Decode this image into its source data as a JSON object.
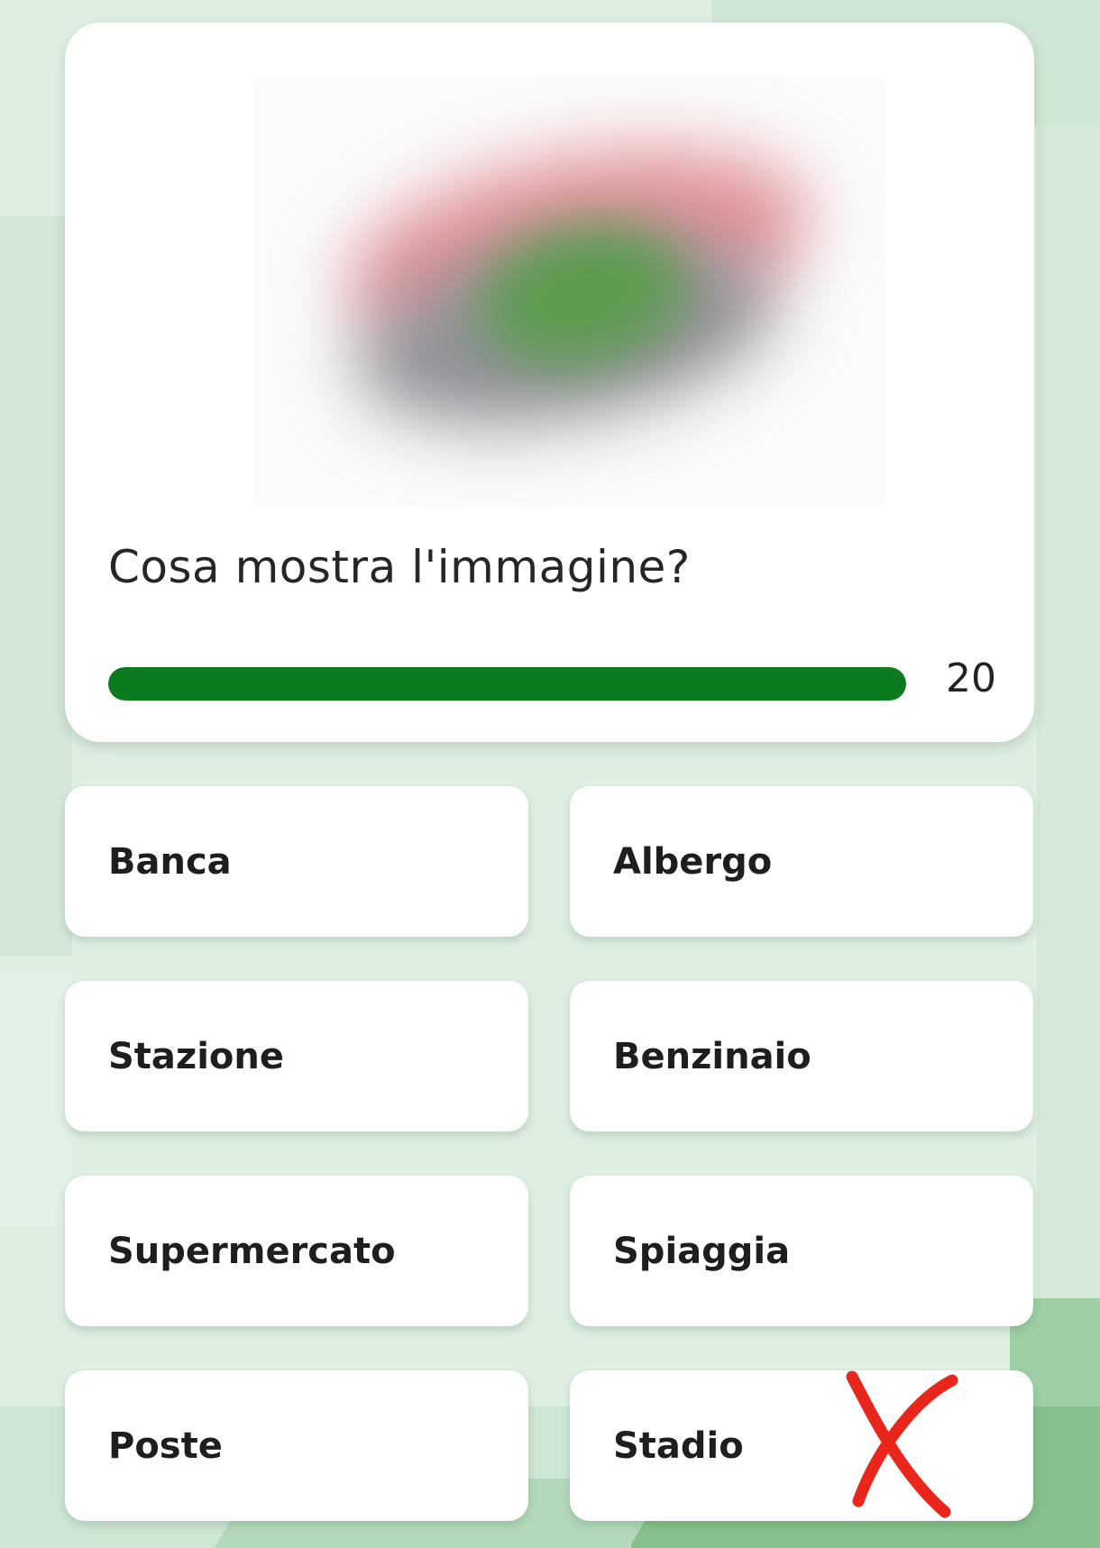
{
  "quiz": {
    "question": "Cosa mostra l'immagine?",
    "timer_value": "20",
    "timer_fraction": 1.0,
    "timer_color": "#0c7a1f"
  },
  "answers": [
    {
      "label": "Banca"
    },
    {
      "label": "Albergo"
    },
    {
      "label": "Stazione"
    },
    {
      "label": "Benzinaio"
    },
    {
      "label": "Supermercato"
    },
    {
      "label": "Spiaggia"
    },
    {
      "label": "Poste"
    },
    {
      "label": "Stadio"
    }
  ],
  "annotation": {
    "icon": "red-x-mark-icon",
    "color": "#e8261b",
    "on_answer": "Stadio"
  }
}
